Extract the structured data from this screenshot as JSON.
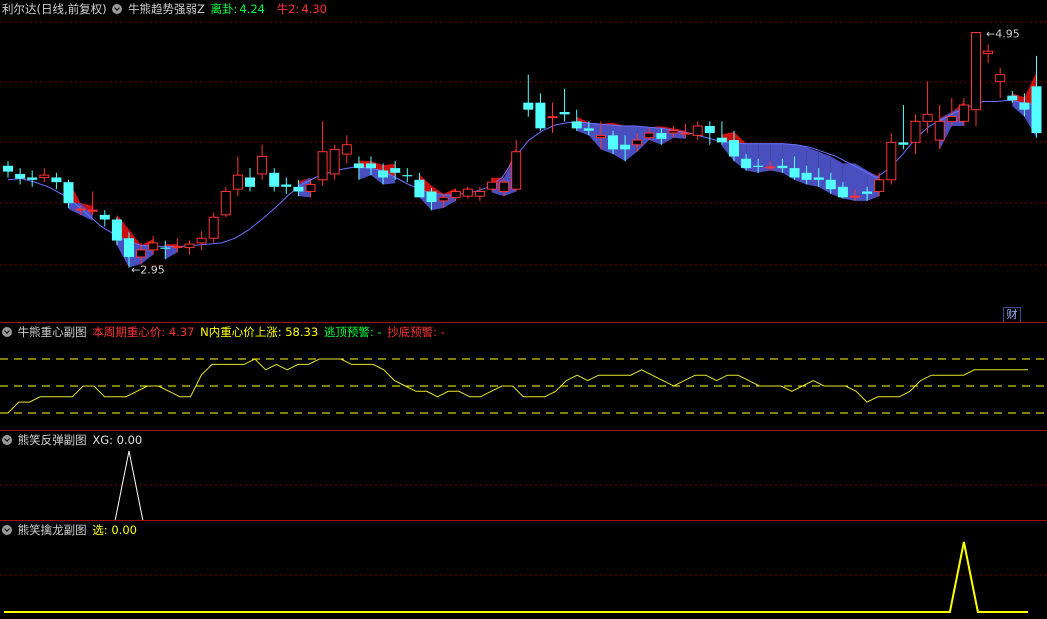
{
  "main": {
    "stock_title": "利尔达(日线,前复权)",
    "indicator": "牛熊趋势强弱Z",
    "f1_label": "离卦:",
    "f1_value": "4.24",
    "f2_label": "牛2:",
    "f2_value": "4.30",
    "high_label": "4.95",
    "low_label": "2.95",
    "cai_label": "财"
  },
  "sub1": {
    "title": "牛熊重心副图",
    "f1": "本周期重心价: 4.37",
    "f2": "N内重心价上涨: 58.33",
    "f3": "逃顶预警: -",
    "f4": "抄底预警: -"
  },
  "sub2": {
    "title": "熊笑反弹副图",
    "f1": "XG: 0.00"
  },
  "sub3": {
    "title": "熊笑擒龙副图",
    "f1": "选: 0.00"
  },
  "colors": {
    "up": "#ff3232",
    "down": "#54ffff",
    "cloud_red": "#cc1010",
    "cloud_blue": "#4a4fc0",
    "ma": "#6a70ff",
    "yellow": "#ffff00",
    "white": "#ffffff",
    "grid": "#7a0000"
  },
  "chart_data": [
    {
      "type": "candlestick",
      "title": "牛熊趋势强弱Z",
      "y_range": [
        2.8,
        5.05
      ],
      "ohlc": [
        [
          3.82,
          3.86,
          3.72,
          3.77
        ],
        [
          3.75,
          3.8,
          3.66,
          3.71
        ],
        [
          3.72,
          3.78,
          3.64,
          3.7
        ],
        [
          3.72,
          3.8,
          3.68,
          3.74
        ],
        [
          3.72,
          3.76,
          3.62,
          3.68
        ],
        [
          3.68,
          3.7,
          3.46,
          3.5
        ],
        [
          3.45,
          3.48,
          3.4,
          3.45
        ],
        [
          3.44,
          3.6,
          3.4,
          3.44
        ],
        [
          3.4,
          3.44,
          3.3,
          3.36
        ],
        [
          3.36,
          3.38,
          3.14,
          3.18
        ],
        [
          3.2,
          3.25,
          2.95,
          3.04
        ],
        [
          3.04,
          3.16,
          2.98,
          3.1
        ],
        [
          3.1,
          3.22,
          3.06,
          3.16
        ],
        [
          3.12,
          3.18,
          3.02,
          3.11
        ],
        [
          3.12,
          3.2,
          3.08,
          3.13
        ],
        [
          3.12,
          3.18,
          3.06,
          3.15
        ],
        [
          3.16,
          3.26,
          3.1,
          3.2
        ],
        [
          3.2,
          3.42,
          3.16,
          3.38
        ],
        [
          3.4,
          3.64,
          3.38,
          3.6
        ],
        [
          3.62,
          3.9,
          3.56,
          3.74
        ],
        [
          3.72,
          3.8,
          3.6,
          3.64
        ],
        [
          3.75,
          4.0,
          3.7,
          3.9
        ],
        [
          3.76,
          3.8,
          3.6,
          3.64
        ],
        [
          3.66,
          3.72,
          3.58,
          3.64
        ],
        [
          3.64,
          3.7,
          3.56,
          3.6
        ],
        [
          3.6,
          3.7,
          3.55,
          3.66
        ],
        [
          3.7,
          4.2,
          3.65,
          3.94
        ],
        [
          3.75,
          4.0,
          3.7,
          3.96
        ],
        [
          3.92,
          4.08,
          3.84,
          4.0
        ],
        [
          3.84,
          3.9,
          3.7,
          3.8
        ],
        [
          3.84,
          3.9,
          3.74,
          3.8
        ],
        [
          3.78,
          3.84,
          3.66,
          3.72
        ],
        [
          3.8,
          3.86,
          3.7,
          3.76
        ],
        [
          3.74,
          3.8,
          3.68,
          3.73
        ],
        [
          3.7,
          3.76,
          3.55,
          3.55
        ],
        [
          3.6,
          3.63,
          3.44,
          3.51
        ],
        [
          3.52,
          3.58,
          3.46,
          3.55
        ],
        [
          3.55,
          3.62,
          3.52,
          3.6
        ],
        [
          3.56,
          3.64,
          3.54,
          3.62
        ],
        [
          3.56,
          3.64,
          3.52,
          3.6
        ],
        [
          3.62,
          3.72,
          3.6,
          3.68
        ],
        [
          3.6,
          3.7,
          3.56,
          3.68
        ],
        [
          3.62,
          4.04,
          3.6,
          3.94
        ],
        [
          4.36,
          4.6,
          4.24,
          4.3
        ],
        [
          4.36,
          4.44,
          4.12,
          4.14
        ],
        [
          4.24,
          4.36,
          4.1,
          4.24
        ],
        [
          4.28,
          4.48,
          4.2,
          4.26
        ],
        [
          4.2,
          4.3,
          4.12,
          4.14
        ],
        [
          4.14,
          4.2,
          4.08,
          4.12
        ],
        [
          4.06,
          4.2,
          3.96,
          4.08
        ],
        [
          4.08,
          4.12,
          3.92,
          3.96
        ],
        [
          4.0,
          4.08,
          3.86,
          3.96
        ],
        [
          4.0,
          4.1,
          3.94,
          4.04
        ],
        [
          4.06,
          4.14,
          4.04,
          4.1
        ],
        [
          4.1,
          4.14,
          4.0,
          4.05
        ],
        [
          4.1,
          4.16,
          4.06,
          4.12
        ],
        [
          4.1,
          4.18,
          4.06,
          4.1
        ],
        [
          4.08,
          4.2,
          4.04,
          4.16
        ],
        [
          4.16,
          4.2,
          4.0,
          4.1
        ],
        [
          4.06,
          4.2,
          4.0,
          4.02
        ],
        [
          4.04,
          4.12,
          3.86,
          3.9
        ],
        [
          3.88,
          3.92,
          3.78,
          3.8
        ],
        [
          3.82,
          3.88,
          3.76,
          3.81
        ],
        [
          3.81,
          3.86,
          3.78,
          3.81
        ],
        [
          3.82,
          3.88,
          3.76,
          3.8
        ],
        [
          3.8,
          3.9,
          3.7,
          3.72
        ],
        [
          3.76,
          3.82,
          3.66,
          3.7
        ],
        [
          3.72,
          3.8,
          3.64,
          3.7
        ],
        [
          3.7,
          3.76,
          3.58,
          3.62
        ],
        [
          3.64,
          3.68,
          3.54,
          3.55
        ],
        [
          3.56,
          3.62,
          3.52,
          3.56
        ],
        [
          3.6,
          3.64,
          3.52,
          3.58
        ],
        [
          3.6,
          3.76,
          3.56,
          3.7
        ],
        [
          3.7,
          4.1,
          3.66,
          4.02
        ],
        [
          4.02,
          4.34,
          3.96,
          4.0
        ],
        [
          4.02,
          4.26,
          3.92,
          4.2
        ],
        [
          4.2,
          4.54,
          4.1,
          4.26
        ],
        [
          4.04,
          4.34,
          3.96,
          4.2
        ],
        [
          4.2,
          4.4,
          4.16,
          4.24
        ],
        [
          4.2,
          4.4,
          4.16,
          4.34
        ],
        [
          4.3,
          4.95,
          4.16,
          4.96
        ],
        [
          4.78,
          4.86,
          4.7,
          4.8
        ],
        [
          4.54,
          4.66,
          4.4,
          4.6
        ],
        [
          4.42,
          4.46,
          4.36,
          4.38
        ],
        [
          4.36,
          4.44,
          4.24,
          4.3
        ],
        [
          4.5,
          4.76,
          4.06,
          4.1
        ]
      ],
      "ma_line": [
        3.7,
        3.71,
        3.68,
        3.64,
        3.58,
        3.5,
        3.4,
        3.3,
        3.23,
        3.17,
        3.14,
        3.13,
        3.13,
        3.13,
        3.14,
        3.15,
        3.16,
        3.2,
        3.27,
        3.36,
        3.46,
        3.57,
        3.66,
        3.72,
        3.76,
        3.79,
        3.81,
        3.8,
        3.78,
        3.72,
        3.66,
        3.61,
        3.58,
        3.57,
        3.58,
        3.6,
        3.64,
        3.72,
        3.9,
        4.04,
        4.12,
        4.17,
        4.19,
        4.19,
        4.18,
        4.17,
        4.16,
        4.16,
        4.15,
        4.14,
        4.12,
        4.1,
        4.07,
        4.04,
        4.02,
        4.01,
        4.01,
        4.01,
        4.01,
        4.0,
        3.98,
        3.94,
        3.9,
        3.84,
        3.78,
        3.72,
        3.8,
        3.92,
        4.06,
        4.16,
        4.22,
        4.28,
        4.33,
        4.37,
        4.37,
        4.38,
        4.36,
        4.34
      ],
      "annotations": [
        "4.95",
        "2.95"
      ]
    },
    {
      "type": "line",
      "title": "牛熊重心副图",
      "series": [
        {
          "values": [
            44.4,
            55.6,
            55.6,
            61.1,
            61.1,
            61.1,
            61.1,
            72.2,
            72.2,
            61.1,
            61.1,
            61.1,
            66.7,
            72.2,
            72.2,
            66.7,
            61.1,
            61.1,
            83.3,
            94.4,
            94.4,
            94.4,
            94.4,
            100,
            88.9,
            94.4,
            88.9,
            94.4,
            94.4,
            100,
            100,
            100,
            94.4,
            94.4,
            94.4,
            88.9,
            77.8,
            72.2,
            66.7,
            66.7,
            61.1,
            66.7,
            66.7,
            61.1,
            61.1,
            66.7,
            72.2,
            72.2,
            61.1,
            61.1,
            61.1,
            66.7,
            77.8,
            83.3,
            77.8,
            83.3,
            83.3,
            83.3,
            83.3,
            88.9,
            83.3,
            77.8,
            72.2,
            77.8,
            83.3,
            83.3,
            77.8,
            83.3,
            83.3,
            77.8,
            72.2,
            72.2,
            72.2,
            66.7,
            72.2,
            77.8,
            72.2,
            72.2,
            72.2,
            66.7,
            55.6,
            61.1,
            61.1,
            61.1,
            66.7,
            77.8,
            83.3,
            83.3,
            83.3,
            83.3,
            88.9,
            88.9,
            88.9,
            88.9,
            88.9,
            88.9
          ]
        }
      ],
      "reference_lines": [
        25,
        50,
        75,
        100
      ]
    },
    {
      "type": "line",
      "title": "熊笑反弹副图",
      "series": [
        {
          "name": "XG",
          "spike_bar": 10,
          "values_baseline": 0,
          "spike_value": 1
        }
      ]
    },
    {
      "type": "line",
      "title": "熊笑擒龙副图",
      "series": [
        {
          "name": "选",
          "spike_bar": 79,
          "values_baseline": 0,
          "spike_value": 1
        }
      ]
    }
  ]
}
